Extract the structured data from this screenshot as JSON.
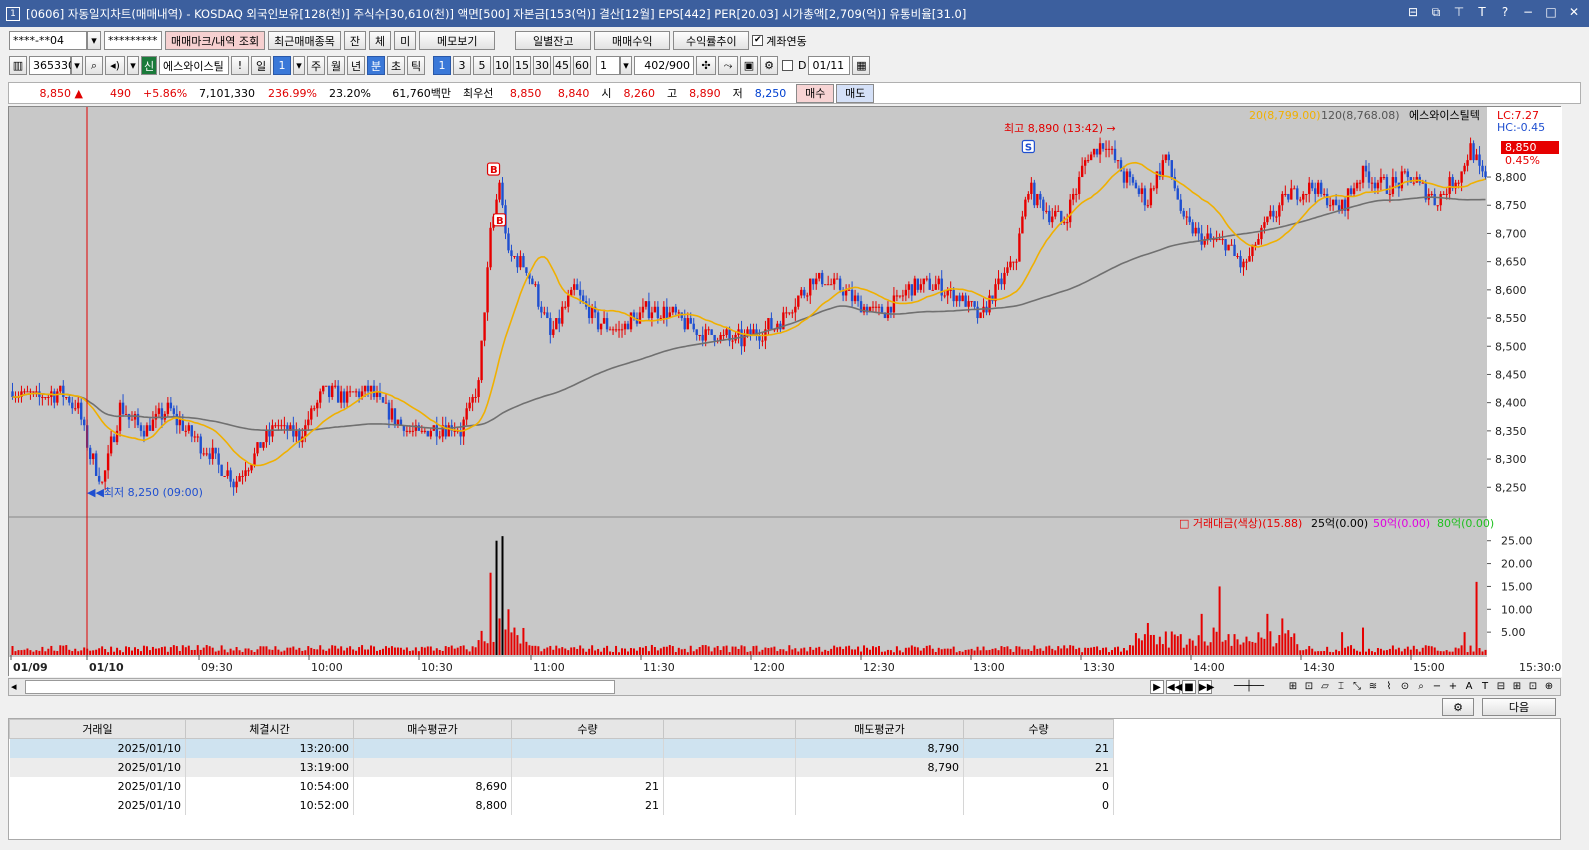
{
  "window": {
    "title": "[0606] 자동일지차트(매매내역) - KOSDAQ 외국인보유[128(천)] 주식수[30,610(천)] 액면[500] 자본금[153(억)] 결산[12월] EPS[442] PER[20.03] 시가총액[2,709(억)] 유통비율[31.0]",
    "app_icon": "1"
  },
  "toolbar1": {
    "account": "****-**04",
    "password": "*********",
    "btn_mark": "매매마크/내역 조회",
    "btn_recent": "최근매매종목",
    "btn_jan": "잔",
    "btn_che": "체",
    "btn_mi": "미",
    "btn_memo": "메모보기",
    "btn_daily": "일별잔고",
    "btn_profit": "매매수익",
    "btn_trend": "수익률추이",
    "link_label": "계좌연동"
  },
  "toolbar2": {
    "code": "365330",
    "sin": "신",
    "name": "에스와이스틸",
    "excl": "!",
    "period_il": "일",
    "period_val": "1",
    "ju": "주",
    "wol": "월",
    "nyeon": "년",
    "bun": "분",
    "cho": "초",
    "tik": "틱",
    "mins": [
      "1",
      "3",
      "5",
      "10",
      "15",
      "30",
      "45",
      "60"
    ],
    "count_sel": "1",
    "counter": "402",
    "counter_max": "/900",
    "d_label": "D",
    "date": "01/11"
  },
  "ticker": {
    "price": "8,850",
    "arrow": "▲",
    "change": "490",
    "pct": "+5.86%",
    "volume": "7,101,330",
    "vol_ratio": "236.99%",
    "turn": "23.20%",
    "amount": "61,760백만",
    "best_label": "최우선",
    "ask": "8,850",
    "bid": "8,840",
    "open_label": "시",
    "open": "8,260",
    "high_label": "고",
    "high": "8,890",
    "low_label": "저",
    "low": "8,250",
    "buy": "매수",
    "sell": "매도"
  },
  "chart_data": {
    "type": "candlestick",
    "legend_ma20": "20(8,799.00)",
    "legend_ma120": "120(8,768.08)",
    "legend_name": "에스와이스틸텍",
    "lc": "LC:7.27",
    "hc": "HC:-0.45",
    "last_price": "8,850",
    "last_pct": "0.45%",
    "high_note": "최고 8,890 (13:42)",
    "low_note": "최저 8,250 (09:00)",
    "y_ticks": [
      "8,800",
      "8,750",
      "8,700",
      "8,650",
      "8,600",
      "8,550",
      "8,500",
      "8,450",
      "8,400",
      "8,350",
      "8,300",
      "8,250"
    ],
    "y_values": [
      8800,
      8750,
      8700,
      8650,
      8600,
      8550,
      8500,
      8450,
      8400,
      8350,
      8300,
      8250
    ],
    "ylim": [
      8215,
      8910
    ],
    "vol_legend": [
      "거래대금(색상)(15.88)",
      "25억(0.00)",
      "50억(0.00)",
      "80억(0.00)"
    ],
    "vol_ticks": [
      "25.00",
      "20.00",
      "15.00",
      "10.00",
      "5.00"
    ],
    "vol_values": [
      25,
      20,
      15,
      10,
      5
    ],
    "vol_ylim": [
      0,
      28
    ],
    "x_ticks": [
      "01/09",
      "01/10",
      "09:30",
      "10:00",
      "10:30",
      "11:00",
      "11:30",
      "12:00",
      "12:30",
      "13:00",
      "13:30",
      "14:00",
      "14:30",
      "15:00",
      "15:30:00"
    ],
    "markers": [
      "B",
      "B",
      "S"
    ],
    "key_closes": [
      [
        0,
        8420
      ],
      [
        8,
        8410
      ],
      [
        16,
        8420
      ],
      [
        22,
        8390
      ],
      [
        26,
        8310
      ],
      [
        30,
        8260
      ],
      [
        36,
        8390
      ],
      [
        44,
        8350
      ],
      [
        52,
        8390
      ],
      [
        58,
        8350
      ],
      [
        66,
        8310
      ],
      [
        74,
        8260
      ],
      [
        80,
        8300
      ],
      [
        88,
        8360
      ],
      [
        96,
        8340
      ],
      [
        104,
        8420
      ],
      [
        112,
        8410
      ],
      [
        120,
        8420
      ],
      [
        128,
        8370
      ],
      [
        136,
        8340
      ],
      [
        144,
        8360
      ],
      [
        150,
        8350
      ],
      [
        156,
        8430
      ],
      [
        160,
        8700
      ],
      [
        163,
        8790
      ],
      [
        166,
        8660
      ],
      [
        172,
        8640
      ],
      [
        180,
        8520
      ],
      [
        188,
        8600
      ],
      [
        196,
        8540
      ],
      [
        204,
        8530
      ],
      [
        212,
        8570
      ],
      [
        220,
        8560
      ],
      [
        232,
        8520
      ],
      [
        244,
        8510
      ],
      [
        256,
        8540
      ],
      [
        268,
        8620
      ],
      [
        276,
        8610
      ],
      [
        284,
        8570
      ],
      [
        292,
        8560
      ],
      [
        300,
        8600
      ],
      [
        308,
        8610
      ],
      [
        316,
        8590
      ],
      [
        324,
        8550
      ],
      [
        330,
        8610
      ],
      [
        336,
        8660
      ],
      [
        340,
        8780
      ],
      [
        346,
        8740
      ],
      [
        352,
        8720
      ],
      [
        360,
        8840
      ],
      [
        366,
        8860
      ],
      [
        372,
        8800
      ],
      [
        380,
        8760
      ],
      [
        386,
        8840
      ],
      [
        392,
        8720
      ],
      [
        398,
        8690
      ],
      [
        406,
        8680
      ],
      [
        412,
        8640
      ],
      [
        420,
        8720
      ],
      [
        428,
        8770
      ],
      [
        436,
        8780
      ],
      [
        444,
        8740
      ],
      [
        452,
        8810
      ],
      [
        460,
        8780
      ],
      [
        468,
        8800
      ],
      [
        476,
        8760
      ],
      [
        484,
        8800
      ],
      [
        488,
        8850
      ],
      [
        492,
        8800
      ]
    ]
  },
  "nav_buttons": [
    "▶",
    "◀◀",
    "■",
    "▶▶"
  ],
  "tools": [
    "⊞",
    "⊡",
    "▱",
    "⌶",
    "⤡",
    "≋",
    "⌇",
    "⊙",
    "⌕",
    "−",
    "+",
    "A",
    "T",
    "⊟",
    "⊞",
    "⊡",
    "⊕"
  ],
  "table": {
    "headers": [
      "거래일",
      "체결시간",
      "매수평균가",
      "수량",
      "",
      "매도평균가",
      "수량"
    ],
    "rows": [
      [
        "2025/01/10",
        "13:20:00",
        "",
        "",
        "",
        "8,790",
        "21"
      ],
      [
        "2025/01/10",
        "13:19:00",
        "",
        "",
        "",
        "8,790",
        "21"
      ],
      [
        "2025/01/10",
        "10:54:00",
        "8,690",
        "21",
        "",
        "",
        "0"
      ],
      [
        "2025/01/10",
        "10:52:00",
        "8,800",
        "21",
        "",
        "",
        "0"
      ]
    ],
    "next_btn": "다음"
  }
}
